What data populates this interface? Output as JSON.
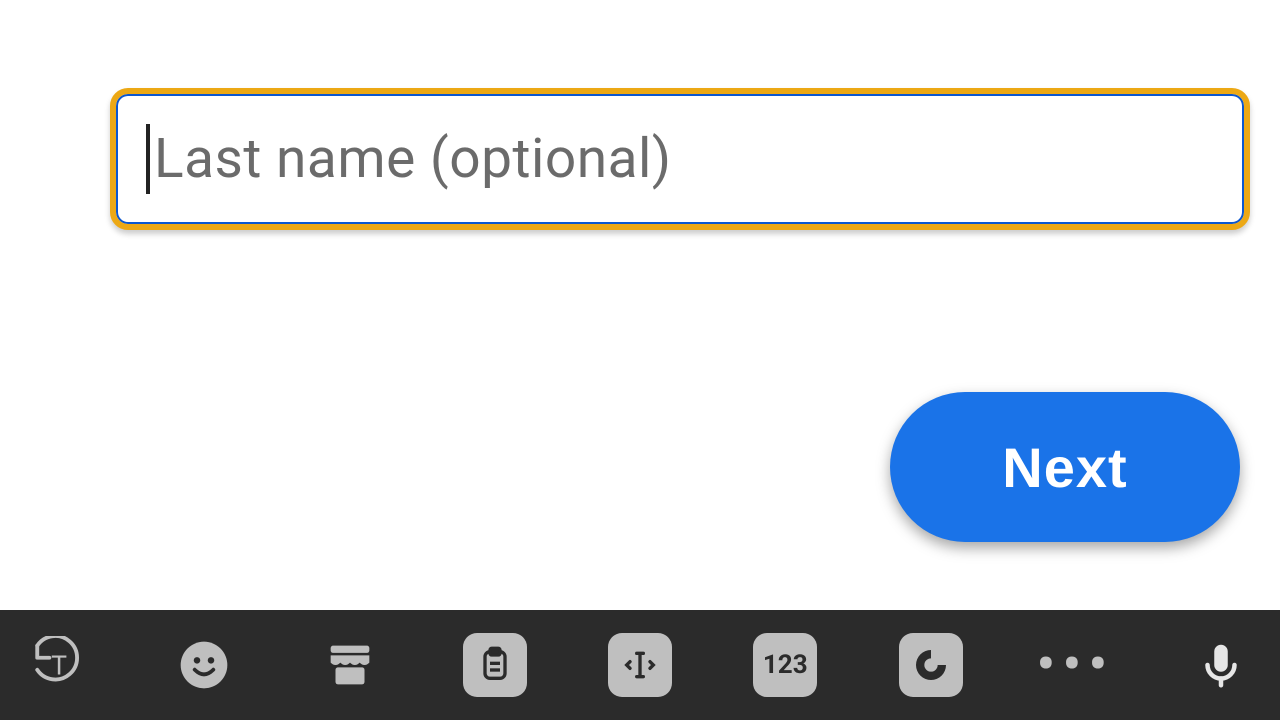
{
  "form": {
    "last_name": {
      "placeholder": "Last name (optional)",
      "value": ""
    },
    "next_label": "Next"
  },
  "keyboard": {
    "numpad_label": "123"
  }
}
